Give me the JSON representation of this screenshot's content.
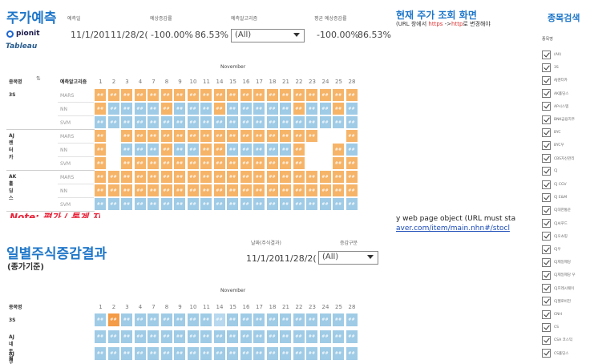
{
  "top": {
    "title": "주가예측",
    "logo_text": "pionit",
    "tableau_text": "Tableau",
    "filters": [
      {
        "label": "예측일",
        "value": "11/1/201"
      },
      {
        "label": "",
        "value": "11/28/2("
      },
      {
        "label": "예상증감률",
        "value": "-100.00%"
      },
      {
        "label": "",
        "value": "86.53%"
      },
      {
        "label": "예측알고리즘",
        "value": "(All)"
      },
      {
        "label": "평균 예상증감률",
        "value": "-100.00%"
      },
      {
        "label": "",
        "value": "86.53%"
      }
    ]
  },
  "grid1": {
    "month": "November",
    "col_stock": "종목명",
    "col_algo": "예측알고리즘",
    "days": [
      "1",
      "2",
      "3",
      "4",
      "7",
      "8",
      "9",
      "10",
      "11",
      "14",
      "15",
      "16",
      "17",
      "18",
      "21",
      "22",
      "23",
      "24",
      "25",
      "28"
    ],
    "cell_text": "##",
    "groups": [
      {
        "name": "3S",
        "rows": [
          {
            "algo": "MARS",
            "cells": "ooooooooooooooooooooo"
          },
          {
            "algo": "NN",
            "cells": "obbbbobbbobbbbbobbob"
          },
          {
            "algo": "SVM",
            "cells": "bbbbbbbbbbbbbbbbbbbb"
          }
        ]
      },
      {
        "name": "AJ렌터카",
        "rows": [
          {
            "algo": "MARS",
            "cells": "owooooooooooooooowwoo"
          },
          {
            "algo": "NN",
            "cells": "owbbbobboobbbbbowwob"
          },
          {
            "algo": "SVM",
            "cells": "owoooooooooooooowwoo"
          }
        ]
      },
      {
        "name": "AK홀딩스",
        "rows": [
          {
            "algo": "MARS",
            "cells": "oooooooooooooooooooo"
          },
          {
            "algo": "NN",
            "cells": "oooooooooooooooooooo"
          },
          {
            "algo": "SVM",
            "cells": "bbbbbbbbbbbbbbbbbbbb"
          }
        ]
      }
    ]
  },
  "right": {
    "title": "현재 주가 조회 화면",
    "sub_pre": "(URL 창에서 ",
    "sub_red1": "https",
    "sub_mid": " ->",
    "sub_red2": "http",
    "sub_post": "로 변경해야",
    "web_obj": "y web page object (URL must sta",
    "web_url": "aver.com/item/main.nhn#/stocl"
  },
  "red_partial": "Note: 평가 / 통계 지",
  "section2": {
    "title": "일별주식증감결과",
    "subtitle": "(종가기준)",
    "date_label": "날짜(주식결과)",
    "date_from": "11/1/20:",
    "date_to": "11/28/2(",
    "gain_label": "증감구분",
    "gain_value": "(All)",
    "month": "November",
    "col_stock": "종목명",
    "rows": [
      {
        "name": "3S",
        "cells": "bdbbbbbbblbbbbbbbbbb"
      },
      {
        "name": "AJ네트웍스",
        "cells": "bbbbbbbbbbbbbbbbbbbb"
      },
      {
        "name": "AJ렌터카",
        "cells": "bbbbbbbbbbbbbbbbbbbb"
      }
    ]
  },
  "search": {
    "title": "종목검색",
    "label": "종목명",
    "items": [
      "(All)",
      "3S",
      "AJ렌터카",
      "AK홀딩스",
      "AP시스템",
      "BNK금융지주",
      "BYC",
      "BYC우",
      "CBS자산관리",
      "CJ",
      "CJ CGV",
      "CJ E&M",
      "CJ대한통운",
      "CJ씨푸드",
      "CJ오쇼핑",
      "CJ우",
      "CJ제일제당",
      "CJ제일제당 우",
      "CJ프레시웨이",
      "CJ헬로비전",
      "CNH",
      "CS",
      "CSA 코스믹",
      "CS홀딩스"
    ]
  }
}
